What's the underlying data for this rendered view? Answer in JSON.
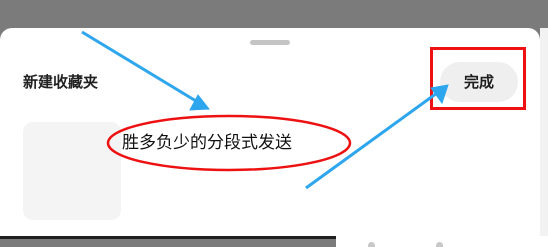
{
  "sheet": {
    "title": "新建收藏夹",
    "done_label": "完成",
    "input_value": "胜多负少的分段式发送"
  },
  "colors": {
    "annotation_red": "#ee1111",
    "annotation_blue": "#2ea6ee"
  }
}
